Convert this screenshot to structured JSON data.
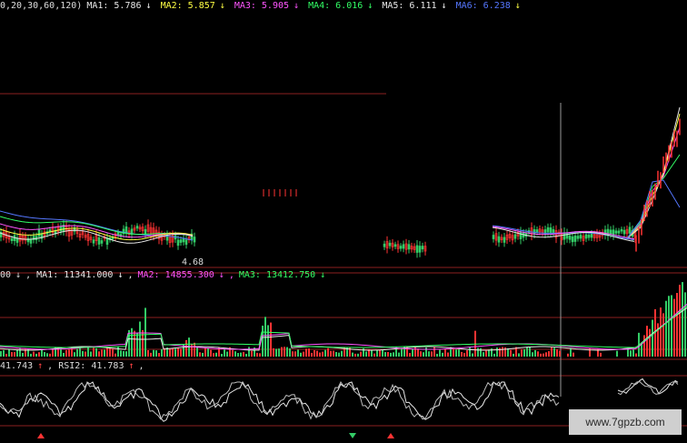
{
  "price_panel": {
    "indicator_text": "0,20,30,60,120)",
    "ma": [
      {
        "label": "MA1: 5.786",
        "arrow": "↓",
        "color": "#e8e8e8"
      },
      {
        "label": "MA2: 5.857",
        "arrow": "↓",
        "color": "#ffff44"
      },
      {
        "label": "MA3: 5.905",
        "arrow": "↓",
        "color": "#ff55ff"
      },
      {
        "label": "MA4: 6.016",
        "arrow": "↓",
        "color": "#33ff66"
      },
      {
        "label": "MA5: 6.111",
        "arrow": "↓",
        "color": "#e8e8e8"
      },
      {
        "label": "MA6: 6.238",
        "arrow": "↓",
        "color": "#5577ff"
      }
    ],
    "low_label": "4.68"
  },
  "volume_panel": {
    "prefix": "00",
    "prefix_arrow": "↓",
    "ma": [
      {
        "label": "MA1: 11341.000",
        "arrow": "↓",
        "color": "#e8e8e8"
      },
      {
        "label": "MA2: 14855.300",
        "arrow": "↓",
        "color": "#ff55ff"
      },
      {
        "label": "MA3: 13412.750",
        "arrow": "↓",
        "color": "#33ff66"
      }
    ]
  },
  "rsi_panel": {
    "rsi1": "41.743",
    "rsi1_arrow": "↑",
    "rsi2": "RSI2: 41.783",
    "rsi2_arrow": "↑"
  },
  "watermark": "www.7gpzb.com",
  "colors": {
    "background": "#000000",
    "up": "#ff3333",
    "down": "#33cc66",
    "grid": "#8b2020",
    "crosshair": "#9a9a9a"
  }
}
